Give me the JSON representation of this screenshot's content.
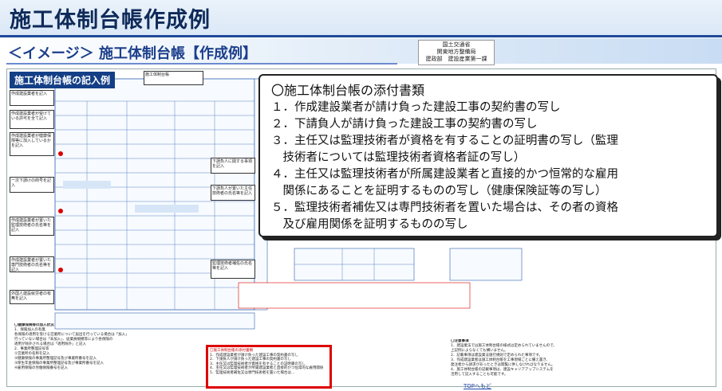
{
  "header": {
    "title": "施工体制台帳作成例",
    "subtitle_prefix": "＜イメージ＞",
    "subtitle_main": "施工体制台帳【作成例】"
  },
  "agency": {
    "line1": "国土交通省",
    "line2": "関東地方整備局",
    "line3": "建政部　建設産業第一課"
  },
  "form": {
    "label": "施工体制台帳の記入例",
    "sheet_title": "施工体制台帳",
    "left_notes": [
      "作成建設業者を記入",
      "作成建設業者が受けている許可を全て記入",
      "作成建設業者が健康保険等に加入しているかを記入",
      "一次下請けの商号を記入",
      "作成建設業者が置いた監理技術者の氏名等を記入",
      "作成建設業者が置いた専門技術者の氏名等を記入",
      "外国人建設就労者の有無を記入"
    ],
    "right_notes": [
      "下請負人に関する事項を記入",
      "下請負人が置いた主任技術者の氏名等を記入",
      "監理技術者補佐の氏名等を記入"
    ]
  },
  "overlay": {
    "heading": "〇施工体制台帳の添付書類",
    "items": [
      "１．作成建設業者が請け負った建設工事の契約書の写し",
      "２．下請負人が請け負った建設工事の契約書の写し",
      "３．主任又は監理技術者が資格を有することの証明書の写し（監理",
      "　技術者については監理技術者資格者証の写し）",
      "４．主任又は監理技術者が所属建設業者と直接的かつ恒常的な雇用",
      "　関係にあることを証明するものの写し（健康保険証等の写し）",
      "５．監理技術者補佐又は専門技術者を置いた場合は、その者の資格",
      "　及び雇用関係を証明するものの写し"
    ]
  },
  "red_callout": {
    "title": "〇施工体制台帳の添付書類",
    "lines": [
      "1．作成建設業者が請け負った建設工事の契約書の写し",
      "2．下請負人が請け負った建設工事の契約書の写し",
      "3．主任又は監理技術者が資格を有することの証明書の写し",
      "4．主任又は監理技術者が所属建設業者と直接的かつ恒常的な雇用関係",
      "5．監理技術者補佐又は専門技術者を置いた場合は…"
    ]
  },
  "bottom_left_notes": {
    "title": "〇健康保険等の加入状況",
    "lines": [
      "1．保険加入の有無",
      "各保険の適用を受ける営業所について届出を行っている場合は「加入」",
      "行っていない場合は「未加入」、従業員規模等により各保険の",
      "適用が除外される場合は「適用除外」と記入",
      "2．事業所整理記号等",
      "①営業所の名称を記入",
      "②健康保険の事業所整理記号及び事業所番号を記入",
      "③厚生年金保険の事業所整理記号及び事業所番号を記入",
      "④雇用保険の労働保険番号を記入"
    ]
  },
  "bottom_right_notes": {
    "title": "〇注意事項",
    "lines": [
      "1．建設業法では施工体制台帳の様式は定められていませんので、",
      "上記例によらなくても構いません。",
      "2．記載事項は建設業法施行規則で定められた事項です。",
      "3．作成建設業者は施工体制台帳を工事現場ごとに備え置き、",
      "発注者から請求があったときは閲覧に供しなければなりません。",
      "4．施工体制台帳の記載事項は、建設キャリアアップシステムを",
      "活用して記入することも可能です。"
    ]
  },
  "footer": {
    "top_link": "TOPへもど"
  },
  "colors": {
    "title_text": "#0e2a59",
    "accent_blue": "#1e4a9a",
    "callout_red": "#d00000"
  }
}
